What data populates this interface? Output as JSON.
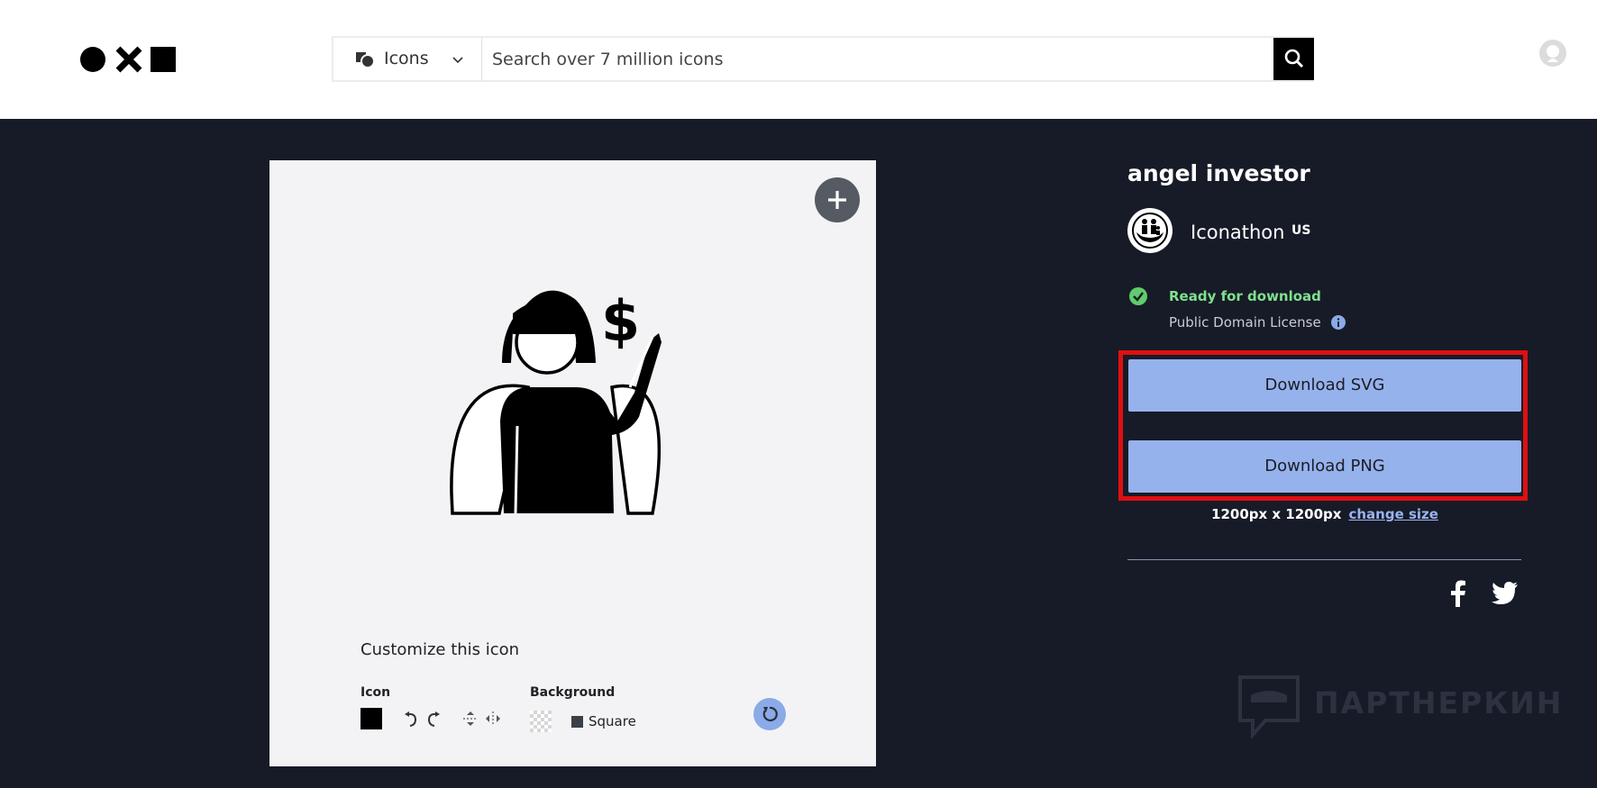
{
  "header": {
    "search": {
      "type_label": "Icons",
      "placeholder": "Search over 7 million icons"
    }
  },
  "canvas": {
    "customize_title": "Customize this icon",
    "icon_label": "Icon",
    "background_label": "Background",
    "shape_label": "Square",
    "icon_color": "#000000",
    "background_shape_color": "#3b3f47"
  },
  "details": {
    "title": "angel investor",
    "creator": {
      "name": "Iconathon",
      "country": "US"
    },
    "status": "Ready for download",
    "license": "Public Domain License",
    "download_svg": "Download SVG",
    "download_png": "Download PNG",
    "size": "1200px x 1200px",
    "change_size": "change size"
  },
  "watermark": {
    "text": "ПАРТНЕРКИН"
  },
  "colors": {
    "page_bg": "#171b27",
    "accent": "#96b2ec",
    "ready": "#7fe08e",
    "highlight": "#e00f12"
  },
  "icons": [
    "logo",
    "shapes-icon",
    "chevron-down-icon",
    "search-icon",
    "user-icon",
    "plus-icon",
    "angel-investor-icon",
    "rotate-left-icon",
    "rotate-right-icon",
    "flip-vertical-icon",
    "flip-horizontal-icon",
    "reset-icon",
    "check-circle-icon",
    "info-icon",
    "facebook-icon",
    "twitter-icon"
  ]
}
